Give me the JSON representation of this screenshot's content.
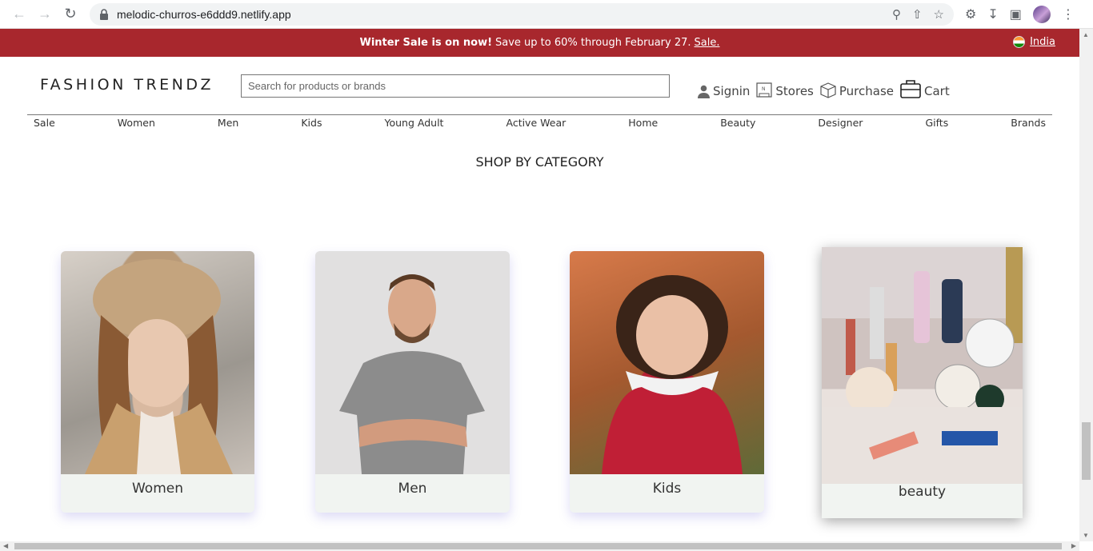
{
  "browser": {
    "url": "melodic-churros-e6ddd9.netlify.app"
  },
  "promo": {
    "headline": "Winter Sale is on now!",
    "text": "Save up to 60% through February 27.",
    "link": "Sale.",
    "country": "India"
  },
  "header": {
    "logo": "FASHION TRENDZ",
    "search_placeholder": "Search for products or brands",
    "links": {
      "signin": "Signin",
      "stores": "Stores",
      "purchase": "Purchase",
      "cart": "Cart"
    }
  },
  "nav": [
    "Sale",
    "Women",
    "Men",
    "Kids",
    "Young Adult",
    "Active Wear",
    "Home",
    "Beauty",
    "Designer",
    "Gifts",
    "Brands"
  ],
  "section": {
    "title": "SHOP BY CATEGORY"
  },
  "categories": [
    "Women",
    "Men",
    "Kids",
    "beauty"
  ]
}
